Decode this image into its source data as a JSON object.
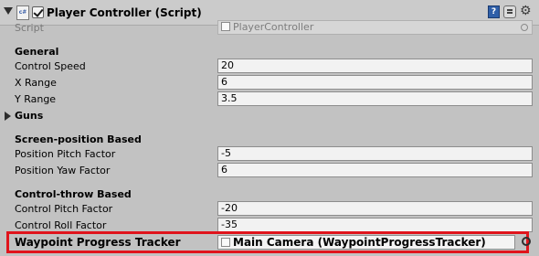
{
  "header": {
    "title": "Player Controller (Script)",
    "script_icon_text": "c#",
    "help_icon_text": "?",
    "gear_icon_text": "⚙",
    "enabled": true
  },
  "script_row": {
    "label": "Script",
    "value": "PlayerController"
  },
  "sections": {
    "general": "General",
    "guns": "Guns",
    "screen_position": "Screen-position Based",
    "control_throw": "Control-throw Based"
  },
  "fields": {
    "control_speed": {
      "label": "Control Speed",
      "value": "20"
    },
    "x_range": {
      "label": "X Range",
      "value": "6"
    },
    "y_range": {
      "label": "Y Range",
      "value": "3.5"
    },
    "position_pitch_factor": {
      "label": "Position Pitch Factor",
      "value": "-5"
    },
    "position_yaw_factor": {
      "label": "Position Yaw Factor",
      "value": "6"
    },
    "control_pitch_factor": {
      "label": "Control Pitch Factor",
      "value": "-20"
    },
    "control_roll_factor": {
      "label": "Control Roll Factor",
      "value": "-35"
    }
  },
  "waypoint": {
    "label": "Waypoint Progress Tracker",
    "value": "Main Camera (WaypointProgressTracker)"
  },
  "colors": {
    "highlight": "#e0141c",
    "panel": "#c2c2c2",
    "help_icon": "#2f5fa8"
  },
  "icons": [
    "foldout-arrow",
    "script-icon",
    "checkbox",
    "help-icon",
    "preset-icon",
    "gear-icon",
    "object-picker-icon"
  ]
}
